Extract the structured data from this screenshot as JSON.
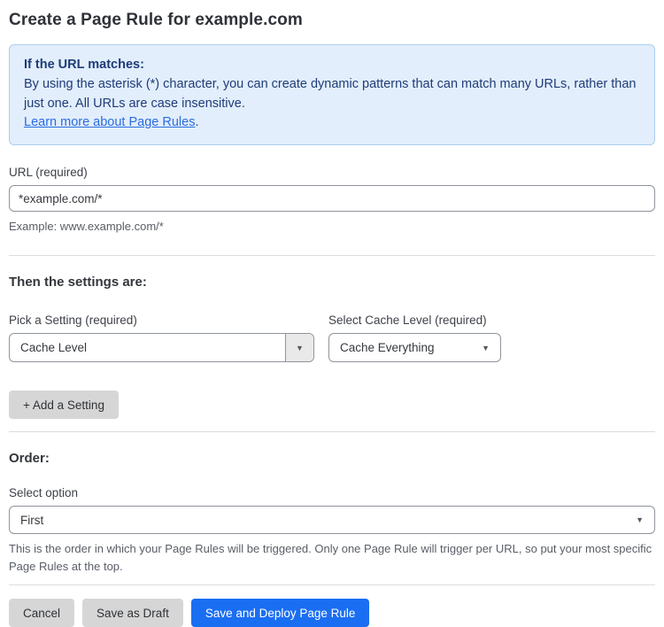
{
  "page": {
    "title": "Create a Page Rule for example.com"
  },
  "colors": {
    "accent_blue": "#1a6ef2",
    "info_box_background": "#e2eefc",
    "info_box_border": "#aecdf0",
    "info_text_navy": "#1f3c78",
    "link_blue": "#2b6cdf",
    "button_gray": "#d6d6d6"
  },
  "info_box": {
    "heading": "If the URL matches:",
    "body": "By using the asterisk (*) character, you can create dynamic patterns that can match many URLs, rather than just one. All URLs are case insensitive.",
    "link_label": "Learn more about Page Rules",
    "link_suffix": "."
  },
  "url_field": {
    "label": "URL (required)",
    "value": "*example.com/*",
    "helper": "Example: www.example.com/*"
  },
  "settings_section": {
    "heading": "Then the settings are:",
    "setting_picker": {
      "label": "Pick a Setting (required)",
      "selected": "Cache Level"
    },
    "cache_level_picker": {
      "label": "Select Cache Level (required)",
      "selected": "Cache Everything"
    },
    "add_setting_label": "+ Add a Setting"
  },
  "order_section": {
    "heading": "Order:",
    "select_label": "Select option",
    "selected": "First",
    "helper": "This is the order in which your Page Rules will be triggered. Only one Page Rule will trigger per URL, so put your most specific Page Rules at the top."
  },
  "footer": {
    "cancel_label": "Cancel",
    "save_draft_label": "Save as Draft",
    "save_deploy_label": "Save and Deploy Page Rule"
  },
  "icons": {
    "dropdown_arrow": "▼"
  }
}
